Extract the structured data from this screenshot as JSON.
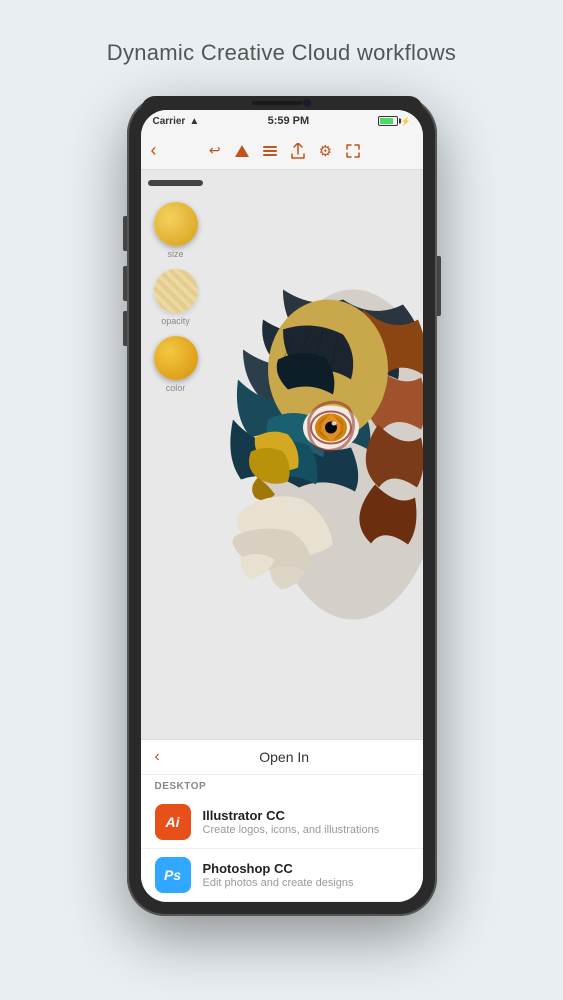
{
  "page": {
    "title": "Dynamic Creative Cloud workflows",
    "background_color": "#e8eef2"
  },
  "status_bar": {
    "carrier": "Carrier",
    "wifi": "WiFi",
    "time": "5:59 PM",
    "battery_level": 85
  },
  "toolbar": {
    "back_label": "‹",
    "undo_label": "↩",
    "icons": [
      "back",
      "undo",
      "triangle",
      "layers",
      "share",
      "settings",
      "expand"
    ]
  },
  "left_panel": {
    "tools": [
      {
        "name": "size",
        "label": "size"
      },
      {
        "name": "opacity",
        "label": "opacity"
      },
      {
        "name": "color",
        "label": "color"
      }
    ]
  },
  "bottom_sheet": {
    "back_label": "‹",
    "title": "Open In",
    "section_label": "DESKTOP",
    "apps": [
      {
        "id": "illustrator",
        "icon_label": "Ai",
        "icon_bg": "#e8501a",
        "name": "Illustrator CC",
        "description": "Create logos, icons, and illustrations"
      },
      {
        "id": "photoshop",
        "icon_label": "Ps",
        "icon_bg": "#31a8ff",
        "name": "Photoshop CC",
        "description": "Edit photos and create designs"
      }
    ]
  }
}
